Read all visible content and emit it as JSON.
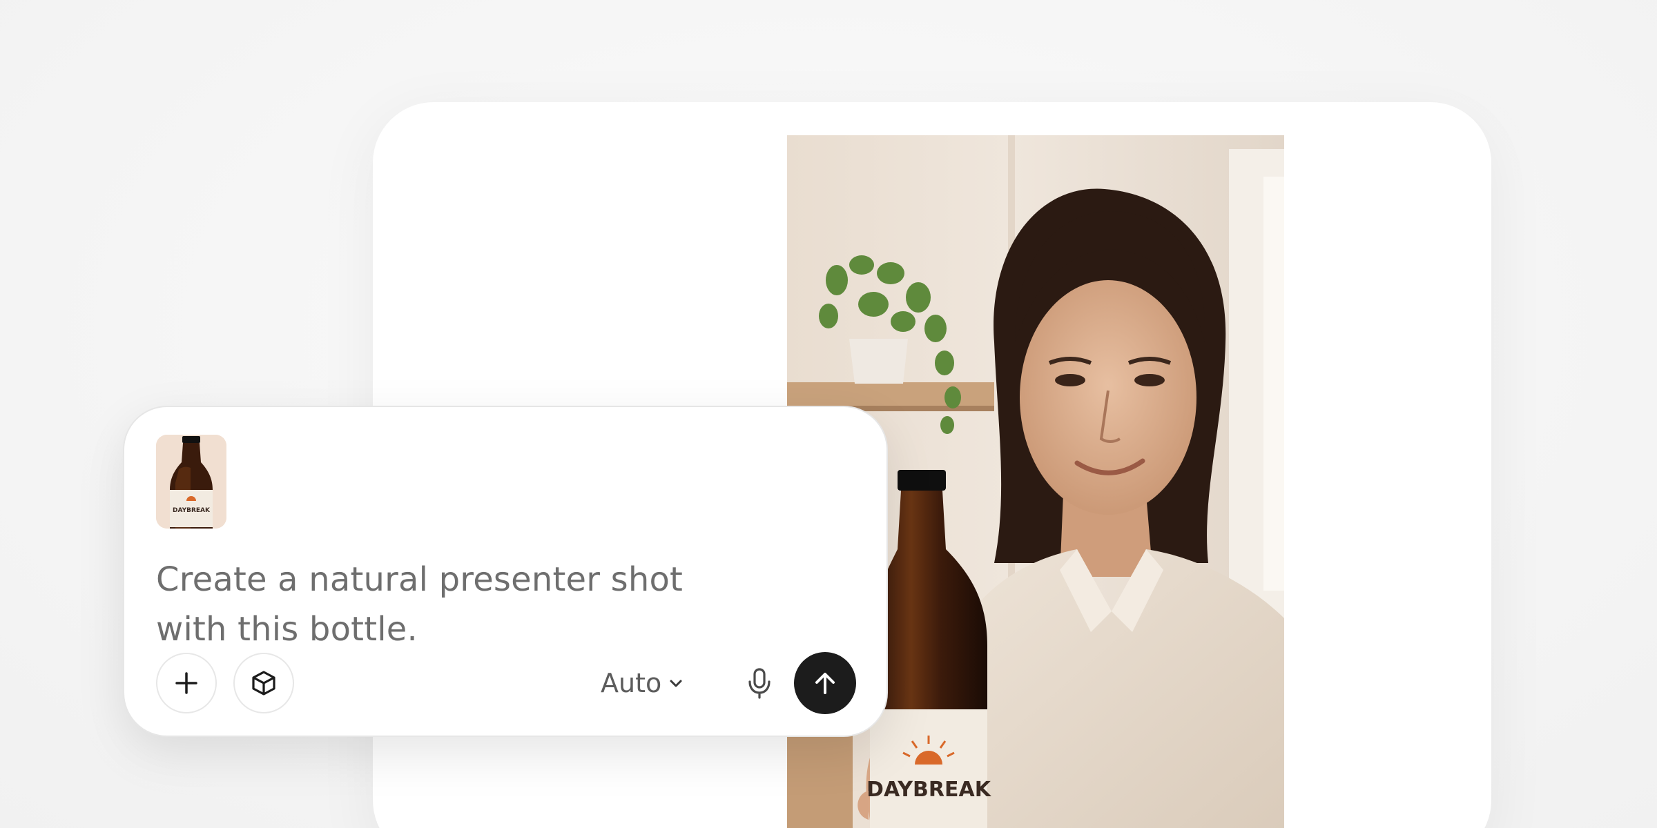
{
  "composer": {
    "attachment": {
      "label": "DAYBREAK"
    },
    "prompt_text": "Create a natural presenter shot with this bottle.",
    "model_selector": {
      "value": "Auto"
    },
    "icons": {
      "add": "plus-icon",
      "cube": "cube-icon",
      "chevron": "chevron-down-icon",
      "mic": "microphone-icon",
      "send": "arrow-up-icon"
    }
  },
  "result_image": {
    "bottle_label": "DAYBREAK"
  },
  "colors": {
    "background": "#f5f5f5",
    "card": "#ffffff",
    "send_button": "#1c1c1c",
    "prompt_text": "#6e6e6e"
  }
}
